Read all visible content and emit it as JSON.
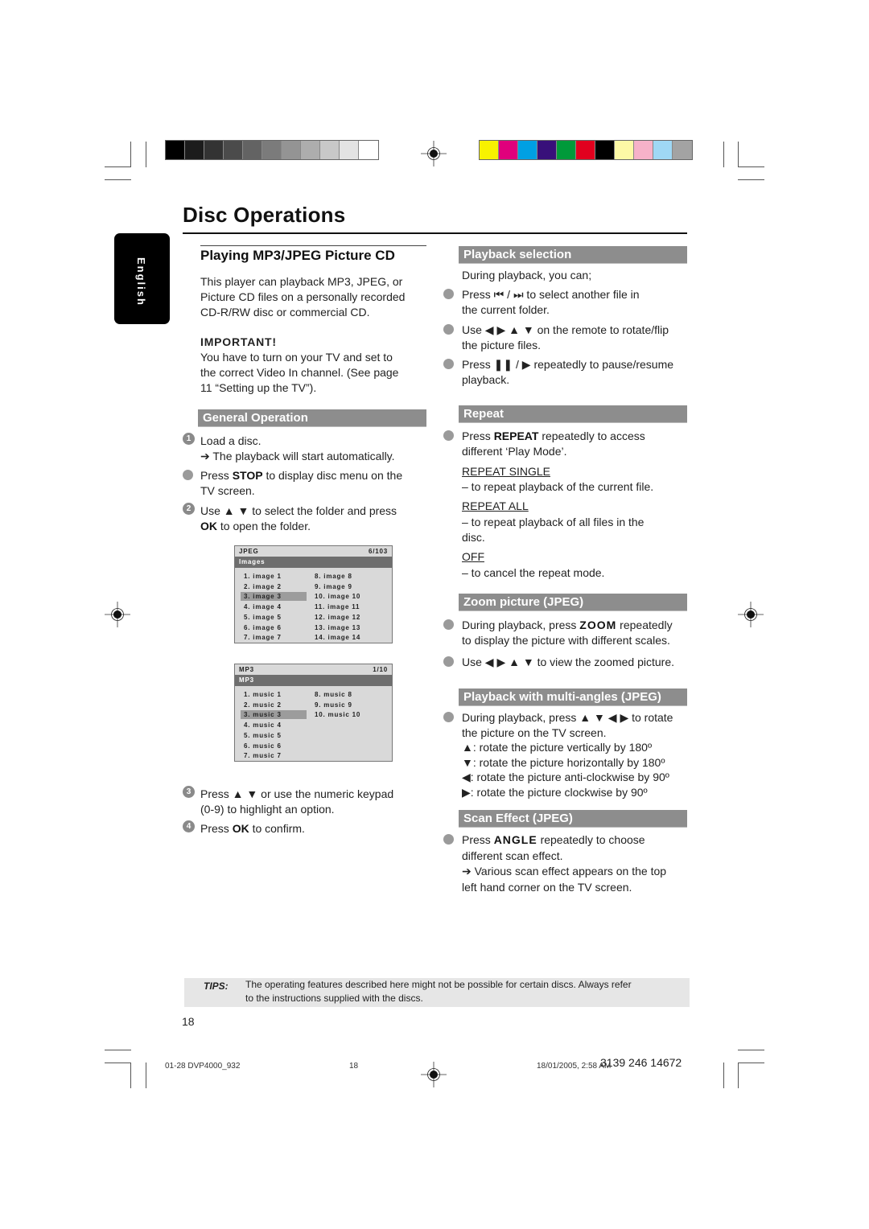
{
  "print_marks": {
    "gray_swatches": [
      "#000000",
      "#1c1c1c",
      "#333333",
      "#4b4b4b",
      "#636363",
      "#7b7b7b",
      "#949494",
      "#adadad",
      "#c8c8c8",
      "#e3e3e3",
      "#ffffff"
    ],
    "color_swatches": [
      "#f7f200",
      "#e0007c",
      "#00a0e3",
      "#38107a",
      "#009a3a",
      "#e1001e",
      "#000000",
      "#fdf9a6",
      "#f6b2c9",
      "#9fd8f5",
      "#a3a3a3"
    ]
  },
  "page": {
    "title": "Disc Operations",
    "language_tab": "English",
    "number": "18"
  },
  "left": {
    "heading": "Playing MP3/JPEG Picture CD",
    "intro": [
      "This player can playback MP3, JPEG, or",
      "Picture CD files on a personally recorded",
      "CD-R/RW  disc or commercial CD."
    ],
    "important_label": "IMPORTANT!",
    "important_text": [
      "You have to turn on your TV and set to",
      "the correct Video In channel.  (See page",
      "11 “Setting up the TV”)."
    ],
    "general_operation": {
      "header": "General Operation",
      "step1_num": "1",
      "step1": "Load a disc.",
      "step1_result": "➔ The playback will start automatically.",
      "stop_pre": "Press ",
      "stop_key": "STOP",
      "stop_post": " to display disc menu on the",
      "stop_post2": "TV screen.",
      "step2_num": "2",
      "step2_pre": "Use ▲ ▼ to select the folder and press",
      "step2_key": "OK",
      "step2_post": " to open the folder.",
      "step3_num": "3",
      "step3_line1": "Press ▲ ▼ or use the numeric keypad",
      "step3_line2": "(0-9) to highlight an option.",
      "step4_num": "4",
      "step4_pre": "Press ",
      "step4_key": "OK",
      "step4_post": " to confirm."
    },
    "jpeg_screen": {
      "type": "JPEG",
      "counter": "6/103",
      "folder": "Images",
      "items": [
        "1. image 1",
        "2. image 2",
        "3. image 3",
        "4. image 4",
        "5. image 5",
        "6. image 6",
        "7. image 7",
        "8. image 8",
        "9. image 9",
        "10. image 10",
        "11. image 11",
        "12. image 12",
        "13. image 13",
        "14. image 14"
      ],
      "selected": "3. image 3"
    },
    "mp3_screen": {
      "type": "MP3",
      "counter": "1/10",
      "folder": "MP3",
      "items": [
        "1. music 1",
        "2. music 2",
        "3. music 3",
        "4. music 4",
        "5. music 5",
        "6. music 6",
        "7. music 7",
        "8. music 8",
        "9. music 9",
        "10. music 10"
      ],
      "selected": "3. music 3"
    }
  },
  "right": {
    "playback_selection": {
      "header": "Playback selection",
      "intro": "During playback, you can;",
      "b1_l1": "Press ⏮ / ⏭ to select another file in",
      "b1_l2": "the current folder.",
      "b2_l1": "Use ◀ ▶ ▲ ▼ on the remote to rotate/flip",
      "b2_l2": "the picture files.",
      "b3_l1": "Press ❚❚ / ▶  repeatedly to pause/resume",
      "b3_l2": "playback."
    },
    "repeat": {
      "header": "Repeat",
      "b1_pre": "Press ",
      "b1_key": "REPEAT",
      "b1_post": "  repeatedly to access",
      "b1_l2": "different ‘Play Mode’.",
      "opt1": "REPEAT SINGLE",
      "opt1_desc": "–     to repeat playback of the current file.",
      "opt2": "REPEAT ALL",
      "opt2_desc": "–     to repeat playback of all files in the",
      "opt2_desc2": "disc.",
      "opt3": "OFF",
      "opt3_desc": "–     to cancel the repeat mode."
    },
    "zoom": {
      "header": "Zoom picture (JPEG)",
      "b1_pre": "During playback, press ",
      "b1_key": "ZOOM",
      "b1_post": " repeatedly",
      "b1_l2": "to display the picture with different scales.",
      "b2": "Use ◀ ▶ ▲ ▼ to view the zoomed picture."
    },
    "multi_angles": {
      "header": "Playback with multi-angles (JPEG)",
      "b1_l1": "During playback, press ▲ ▼ ◀ ▶ to rotate",
      "b1_l2": "the picture on the TV screen.",
      "up": "▲: rotate the picture vertically by 180º",
      "down": "▼: rotate the picture horizontally by 180º",
      "left": "◀: rotate the picture anti-clockwise by 90º",
      "right": "▶: rotate the picture clockwise by 90º"
    },
    "scan_effect": {
      "header": "Scan Effect (JPEG)",
      "b1_pre": "Press ",
      "b1_key": "ANGLE",
      "b1_post": " repeatedly to choose",
      "b1_l2": "different scan effect.",
      "b1_l3": "➔ Various scan effect appears on the top",
      "b1_l4": "left hand corner on the TV screen."
    }
  },
  "tips": {
    "label": "TIPS:",
    "line1": "The operating features described here might not be possible for certain discs.  Always refer",
    "line2": "to the instructions supplied with the discs."
  },
  "slug": {
    "file": "01-28 DVP4000_932",
    "page": "18",
    "date": "18/01/2005, 2:58 AM",
    "code": "3139 246 14672"
  }
}
